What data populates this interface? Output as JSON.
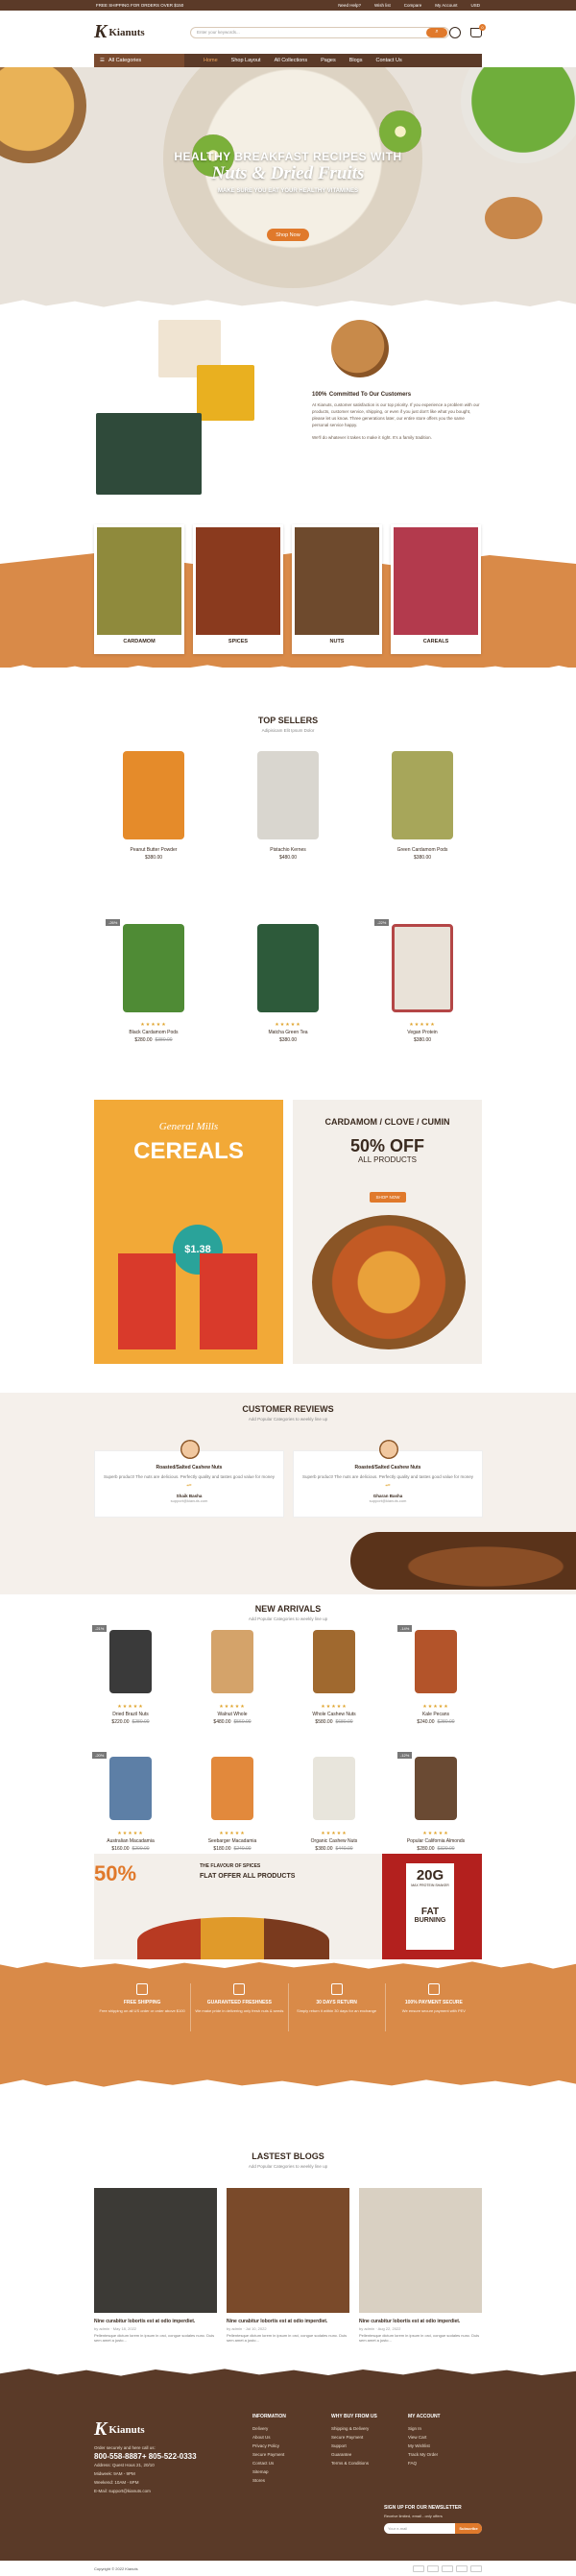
{
  "topbar": {
    "left_text": "FREE SHIPPING FOR ORDERS OVER $150",
    "links": [
      "Need Help?",
      "Wish list",
      "Compare",
      "My Account",
      "USD"
    ]
  },
  "header": {
    "logo_text": "Kianuts",
    "search_placeholder": "Enter your keywords...",
    "cart_count": "0"
  },
  "nav": {
    "categories_label": "All Categories",
    "items": [
      "Home",
      "Shop Layout",
      "All Collections",
      "Pages",
      "Blogs",
      "Contact Us"
    ]
  },
  "hero": {
    "line1": "HEALTHY BREAKFAST RECIPES WITH",
    "line2": "Nuts & Dried Fruits",
    "line3": "MAKE SURE YOU EAT YOUR HEALTHY VITAMINES",
    "button": "Shop Now"
  },
  "about": {
    "title_big": "100%",
    "title_rest": "Committed To Our Customers",
    "p1": "At Kianuts, customer satisfaction is our top priority. If you experience a problem with our products, customer service, shipping, or even if you just don't like what you bought, please let us know. Three generations later, our entire store offers you the same personal service happy.",
    "p2": "We'll do whatever it takes to make it right. It's a family tradition."
  },
  "categories": [
    "CARDAMOM",
    "SPICES",
    "NUTS",
    "CAREALS"
  ],
  "top_sellers": {
    "title": "TOP SELLERS",
    "subtitle": "Adipisicam Elit Ipsum Dolor",
    "products": [
      {
        "name": "Peanut Butter Powder",
        "price": "$380.00",
        "old": ""
      },
      {
        "name": "Pistachio Kernes",
        "price": "$480.00",
        "old": ""
      },
      {
        "name": "Green Cardamom Pods",
        "price": "$380.00",
        "old": ""
      },
      {
        "name": "Black Cardamom Pods",
        "price": "$280.00",
        "old": "$380.00",
        "badge": "-26%"
      },
      {
        "name": "Matcha Green Tea",
        "price": "$380.00",
        "old": ""
      },
      {
        "name": "Vegan Protein",
        "price": "$380.00",
        "old": "",
        "badge": "-22%"
      }
    ]
  },
  "promo": {
    "left_brand": "General Mills",
    "left_title": "CEREALS",
    "left_price": "$1.38",
    "right_title": "CARDAMOM / CLOVE / CUMIN",
    "right_offer": "50% OFF",
    "right_sub": "ALL PRODUCTS",
    "right_button": "SHOP NOW"
  },
  "reviews": {
    "title": "CUSTOMER REVIEWS",
    "subtitle": "Add Popular Categories to weekly line up",
    "items": [
      {
        "title": "Roasted/Salted Cashew Nuts",
        "body": "Superb product! The nuts are delicious. Perfectly quality and tastes good value for money",
        "name": "Shaik Basha",
        "mail": "support@kianuts.com"
      },
      {
        "title": "Roasted/Salted Cashew Nuts",
        "body": "Superb product! The nuts are delicious. Perfectly quality and tastes good value for money",
        "name": "Gharan Basha",
        "mail": "support@kianuts.com"
      }
    ]
  },
  "arrivals": {
    "title": "NEW ARRIVALS",
    "subtitle": "Add Popular Categories to weekly line up",
    "products": [
      {
        "name": "Dried Brazil Nuts",
        "price": "$220.00",
        "old": "$280.00",
        "badge": "-21%"
      },
      {
        "name": "Walnut Whole",
        "price": "$480.00",
        "old": "$560.00"
      },
      {
        "name": "Whole Cashew Nuts",
        "price": "$580.00",
        "old": "$680.00"
      },
      {
        "name": "Kale Pecans",
        "price": "$240.00",
        "old": "$280.00",
        "badge": "-14%"
      },
      {
        "name": "Australian Macadamia",
        "price": "$160.00",
        "old": "$200.00",
        "badge": "-20%"
      },
      {
        "name": "Seebarger Macadamia",
        "price": "$180.00",
        "old": "$240.00"
      },
      {
        "name": "Organic Cashew Nuts",
        "price": "$380.00",
        "old": "$440.00"
      },
      {
        "name": "Popular California Almonds",
        "price": "$280.00",
        "old": "$320.00",
        "badge": "-12%"
      }
    ]
  },
  "spices_banner": {
    "off": "50%",
    "t1": "THE FLAVOUR OF SPICES",
    "t2": "FLAT OFFER ALL PRODUCTS",
    "badge_big": "20G",
    "badge_small": "MAX PROTEIN SHAKER",
    "fat": "FAT",
    "burning": "BURNING"
  },
  "features": [
    {
      "title": "FREE SHIPPING",
      "desc": "Free shipping on all US order or order above $100"
    },
    {
      "title": "GUARANTEED FRESHNESS",
      "desc": "We make pride in delivering only fresh nuts & seeds"
    },
    {
      "title": "30 DAYS RETURN",
      "desc": "Simply return it within 30 days for an exchange"
    },
    {
      "title": "100% PAYMENT SECURE",
      "desc": "We ensure secure payment with PEV"
    }
  ],
  "blogs": {
    "title": "LASTEST BLOGS",
    "subtitle": "Add Popular Categories to weekly line up",
    "items": [
      {
        "title": "Nine curabitur lobortis est at odio imperdiet.",
        "meta": "by admin · May 18, 2022",
        "desc": "Pellentesque dictum lorem in ipsum in orci, congue sodales nunc. Duis sem amet a justo..."
      },
      {
        "title": "Nine curabitur lobortis est at odio imperdiet.",
        "meta": "by admin · Jul 10, 2022",
        "desc": "Pellentesque dictum lorem in ipsum in orci, congue sodales nunc. Duis sem amet a justo..."
      },
      {
        "title": "Nine curabitur lobortis est at odio imperdiet.",
        "meta": "by admin · Aug 22, 2022",
        "desc": "Pellentesque dictum lorem in ipsum in orci, congue sodales nunc. Duis sem amet a justo..."
      }
    ]
  },
  "footer": {
    "logo": "Kianuts",
    "contact_intro": "Order securely and here call us:",
    "phone": "800-558-8887+ 805-522-0333",
    "address": "Address: Quest Hous 21, 20/10",
    "hours1": "Midweek: 9AM - 9PM",
    "hours2": "Weekend: 10AM - 6PM",
    "email": "E-Mail: support@kianuts.com",
    "col1_title": "INFORMATION",
    "col1": [
      "Delivery",
      "About Us",
      "Privacy Policy",
      "Secure Payment",
      "Contact Us",
      "Sitemap",
      "Stores"
    ],
    "col2_title": "WHY BUY FROM US",
    "col2": [
      "Shipping & Delivery",
      "Secure Payment",
      "Support",
      "Guarantee",
      "Terms & Conditions"
    ],
    "col3_title": "MY ACCOUNT",
    "col3": [
      "Sign In",
      "View Cart",
      "My Wishlist",
      "Track My Order",
      "FAQ"
    ],
    "news_title": "SIGN UP FOR OUR NEWSLETTER",
    "news_desc": "Receive limited, email - only offers",
    "news_placeholder": "Your e-mail",
    "news_button": "Subscribe",
    "copyright": "Copyright © 2022 Kianuts"
  },
  "colors": {
    "brown": "#5b3a28",
    "orange": "#e0792b",
    "cream": "#f5f0eb"
  }
}
